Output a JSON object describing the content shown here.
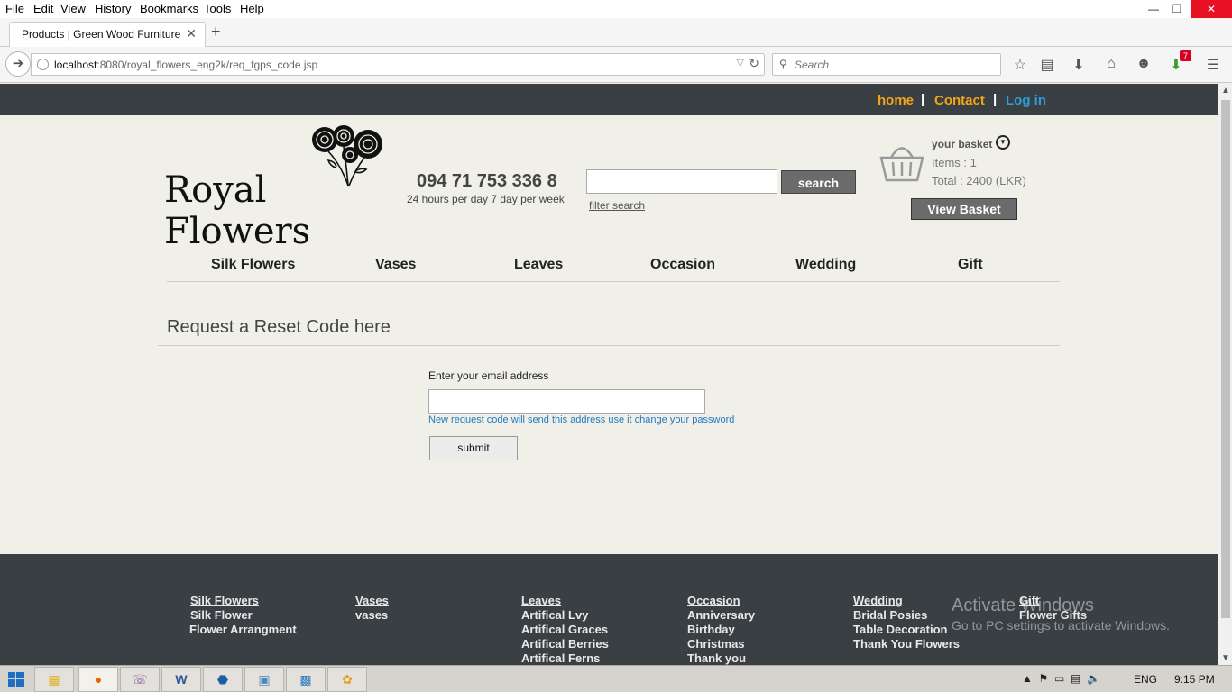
{
  "browser": {
    "menu": [
      "File",
      "Edit",
      "View",
      "History",
      "Bookmarks",
      "Tools",
      "Help"
    ],
    "tab_title": "Products | Green Wood Furniture",
    "url_host": "localhost",
    "url_rest": ":8080/royal_flowers_eng2k/req_fgps_code.jsp",
    "search_placeholder": "Search",
    "notification_count": "7"
  },
  "site": {
    "top_links": {
      "home": "home",
      "contact": "Contact",
      "login": "Log in",
      "separator": "|"
    },
    "colors": {
      "home": "#f2a51a",
      "contact": "#f2a51a",
      "login": "#2a9fdc",
      "topbar": "#3a3f44"
    },
    "logo_text": "Royal Flowers",
    "phone": "094 71 753 336 8",
    "hours": "24 hours per day 7 day per week",
    "search_button": "search",
    "filter_search": "filter search",
    "basket": {
      "title": "your basket",
      "items": "Items : 1",
      "total": "Total : 2400 (LKR)",
      "view_button": "View Basket"
    },
    "categories": [
      "Silk Flowers",
      "Vases",
      "Leaves",
      "Occasion",
      "Wedding",
      "Gift"
    ],
    "page_title": "Request a Reset Code here",
    "form": {
      "email_label": "Enter your email address",
      "email_value": "",
      "hint": "New request code will send this address use it change your password",
      "submit": "submit"
    },
    "footer": {
      "silk": {
        "head": "Silk Flowers",
        "items": [
          "Silk Flower",
          "Flower Arrangment"
        ]
      },
      "vases": {
        "head": "Vases",
        "items": [
          "vases"
        ]
      },
      "leaves": {
        "head": "Leaves",
        "items": [
          "Artifical Lvy",
          "Artifical Graces",
          "Artifical Berries",
          "Artifical Ferns"
        ]
      },
      "occasion": {
        "head": "Occasion",
        "items": [
          "Anniversary",
          "Birthday",
          "Christmas",
          "Thank you"
        ]
      },
      "wedding": {
        "head": "Wedding",
        "items": [
          "Bridal Posies",
          "Table Decoration",
          "Thank You Flowers"
        ]
      },
      "gift": {
        "head": "Gift",
        "items": [
          "Flower Gifts"
        ]
      }
    },
    "watermark": {
      "title": "Activate Windows",
      "subtitle": "Go to PC settings to activate Windows."
    }
  },
  "taskbar": {
    "lang": "ENG",
    "time": "9:15 PM"
  }
}
